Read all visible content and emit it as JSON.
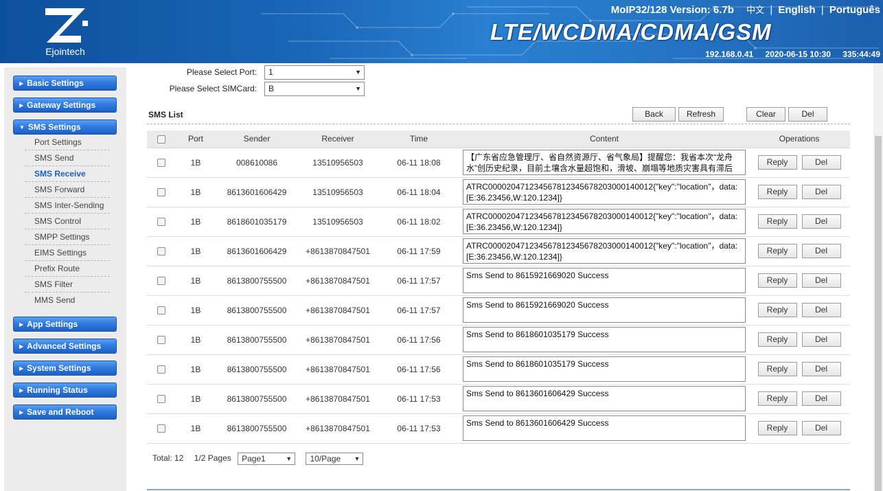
{
  "header": {
    "brand": "Ejointech",
    "version": "MoIP32/128 Version: 6.7b",
    "languages": [
      "中文",
      "English",
      "Português"
    ],
    "tagline": "LTE/WCDMA/CDMA/GSM",
    "ip": "192.168.0.41",
    "datetime": "2020-06-15 10:30",
    "uptime": "335:44:49"
  },
  "sidebar": {
    "menus": [
      {
        "label": "Basic Settings"
      },
      {
        "label": "Gateway Settings"
      },
      {
        "label": "SMS Settings",
        "expanded": true
      },
      {
        "label": "App Settings"
      },
      {
        "label": "Advanced Settings"
      },
      {
        "label": "System Settings"
      },
      {
        "label": "Running Status"
      },
      {
        "label": "Save and Reboot"
      }
    ],
    "sms_submenu": [
      "Port Settings",
      "SMS Send",
      "SMS Receive",
      "SMS Forward",
      "SMS Inter-Sending",
      "SMS Control",
      "SMPP Settings",
      "EIMS Settings",
      "Prefix Route",
      "SMS Filter",
      "MMS Send"
    ],
    "active_submenu": "SMS Receive"
  },
  "filters": {
    "port_label": "Please Select Port:",
    "port_value": "1",
    "sim_label": "Please Select SIMCard:",
    "sim_value": "B"
  },
  "sms_list": {
    "title": "SMS List",
    "buttons": {
      "back": "Back",
      "refresh": "Refresh",
      "clear": "Clear",
      "del": "Del"
    },
    "columns": [
      "Port",
      "Sender",
      "Receiver",
      "Time",
      "Content",
      "Operations"
    ],
    "row_buttons": {
      "reply": "Reply",
      "del": "Del"
    },
    "rows": [
      {
        "port": "1B",
        "sender": "008610086",
        "receiver": "13510956503",
        "time": "06-11 18:08",
        "content": "【广东省应急管理厅、省自然资源厅、省气象局】提醒您：我省本次“龙舟水”创历史纪录，目前土壤含水量超饱和，滑坡、崩塌等地质灾害具有滞后性，"
      },
      {
        "port": "1B",
        "sender": "8613601606429",
        "receiver": "13510956503",
        "time": "06-11 18:04",
        "content": "ATRC000020471234567812345678203000140012{\"key\":\"location\"，data:[E:36.23456,W:120.1234]}"
      },
      {
        "port": "1B",
        "sender": "8618601035179",
        "receiver": "13510956503",
        "time": "06-11 18:02",
        "content": "ATRC000020471234567812345678203000140012{\"key\":\"location\"，data:[E:36.23456,W:120.1234]}"
      },
      {
        "port": "1B",
        "sender": "8613601606429",
        "receiver": "+8613870847501",
        "time": "06-11 17:59",
        "content": "ATRC000020471234567812345678203000140012{\"key\":\"location\"，data:[E:36.23456,W:120.1234]}"
      },
      {
        "port": "1B",
        "sender": "8613800755500",
        "receiver": "+8613870847501",
        "time": "06-11 17:57",
        "content": "Sms Send to 8615921669020 Success"
      },
      {
        "port": "1B",
        "sender": "8613800755500",
        "receiver": "+8613870847501",
        "time": "06-11 17:57",
        "content": "Sms Send to 8615921669020 Success"
      },
      {
        "port": "1B",
        "sender": "8613800755500",
        "receiver": "+8613870847501",
        "time": "06-11 17:56",
        "content": "Sms Send to 8618601035179 Success"
      },
      {
        "port": "1B",
        "sender": "8613800755500",
        "receiver": "+8613870847501",
        "time": "06-11 17:56",
        "content": "Sms Send to 8618601035179 Success"
      },
      {
        "port": "1B",
        "sender": "8613800755500",
        "receiver": "+8613870847501",
        "time": "06-11 17:53",
        "content": "Sms Send to 8613601606429 Success"
      },
      {
        "port": "1B",
        "sender": "8613800755500",
        "receiver": "+8613870847501",
        "time": "06-11 17:53",
        "content": "Sms Send to 8613601606429 Success"
      }
    ]
  },
  "pager": {
    "total": "Total: 12",
    "pages": "1/2 Pages",
    "page_select": "Page1",
    "per_page_select": "10/Page"
  },
  "colors": {
    "accent": "#1d60c4",
    "header": "#1a67b8"
  }
}
